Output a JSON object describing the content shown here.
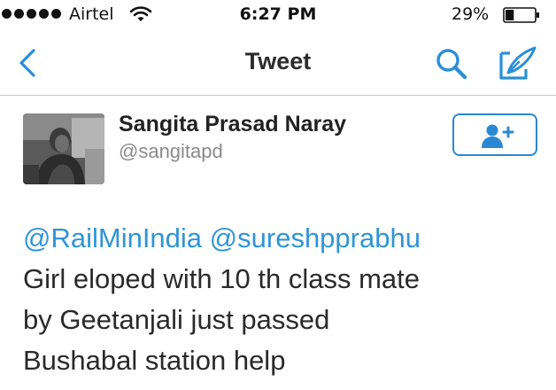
{
  "status_bar": {
    "carrier": "Airtel",
    "time": "6:27 PM",
    "battery_percent": "29%",
    "battery_level": 0.29,
    "signal_bars": 5
  },
  "nav": {
    "title": "Tweet",
    "back_icon": "chevron-left-icon",
    "search_icon": "search-icon",
    "compose_icon": "compose-tweet-icon"
  },
  "tweet": {
    "author_name": "Sangita Prasad Naray",
    "author_handle": "@sangitapd",
    "follow_icon": "add-user-icon",
    "mention_1": "@RailMinIndia",
    "mention_2": "@sureshpprabhu",
    "line_2": "Girl eloped with 10 th class mate",
    "line_3": "by Geetanjali just passed",
    "line_4": "Bushabal station help"
  },
  "colors": {
    "accent": "#2f95d6",
    "button_border": "#2a88d3",
    "text": "#2a2a2a",
    "handle": "#8a8a8a"
  }
}
